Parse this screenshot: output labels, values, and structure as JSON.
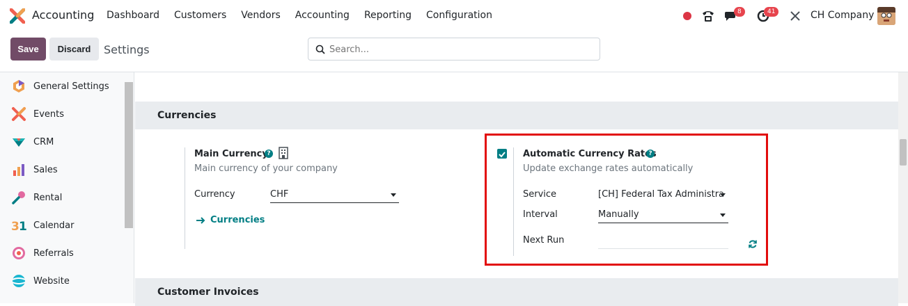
{
  "app": {
    "name": "Accounting"
  },
  "menu": [
    "Dashboard",
    "Customers",
    "Vendors",
    "Accounting",
    "Reporting",
    "Configuration"
  ],
  "systray": {
    "messages_count": "8",
    "activities_count": "41",
    "company": "CH Company"
  },
  "toolbar": {
    "save_label": "Save",
    "discard_label": "Discard",
    "title": "Settings"
  },
  "search": {
    "placeholder": "Search..."
  },
  "sidebar": {
    "items": [
      {
        "label": "General Settings",
        "icon": "general-settings-icon"
      },
      {
        "label": "Events",
        "icon": "events-icon"
      },
      {
        "label": "CRM",
        "icon": "crm-icon"
      },
      {
        "label": "Sales",
        "icon": "sales-icon"
      },
      {
        "label": "Rental",
        "icon": "rental-icon"
      },
      {
        "label": "Calendar",
        "icon": "calendar-icon"
      },
      {
        "label": "Referrals",
        "icon": "referrals-icon"
      },
      {
        "label": "Website",
        "icon": "website-icon"
      }
    ]
  },
  "currencies": {
    "section_title": "Currencies",
    "main_currency": {
      "title": "Main Currency",
      "description": "Main currency of your company",
      "currency_label": "Currency",
      "currency_value": "CHF",
      "link_label": "Currencies"
    },
    "auto_rates": {
      "title": "Automatic Currency Rates",
      "description": "Update exchange rates automatically",
      "enabled": true,
      "service_label": "Service",
      "service_value": "[CH] Federal Tax Administra",
      "interval_label": "Interval",
      "interval_value": "Manually",
      "next_run_label": "Next Run",
      "next_run_value": ""
    }
  },
  "customer_invoices": {
    "section_title": "Customer Invoices"
  },
  "colors": {
    "brand": "#714b67",
    "accent": "#017e84",
    "highlight": "#e20c0c"
  }
}
